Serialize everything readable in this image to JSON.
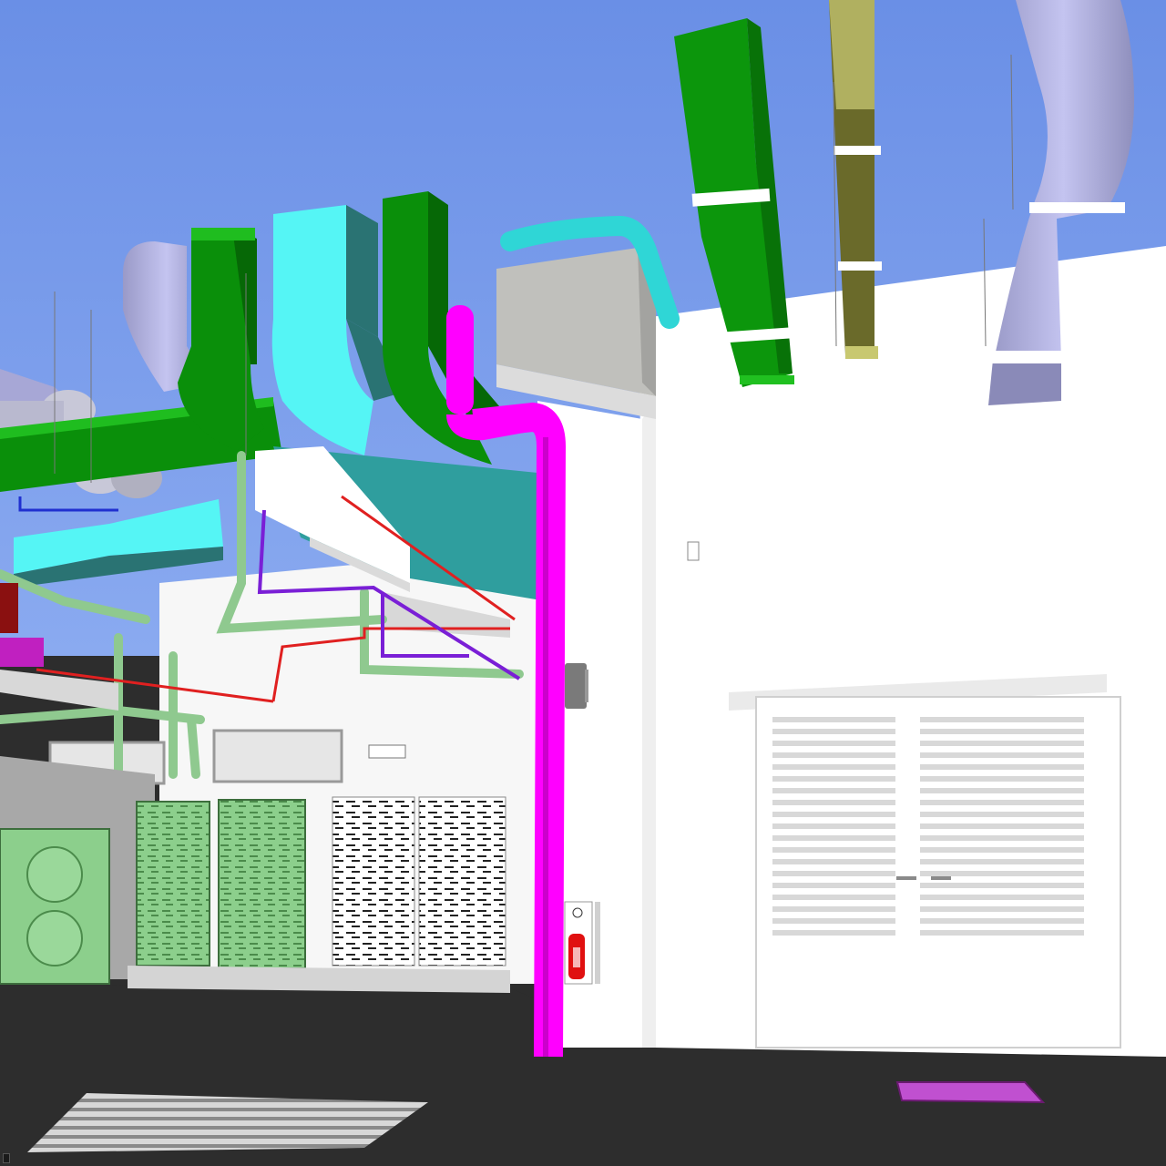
{
  "viewport": {
    "status_text": "",
    "colors": {
      "sky_top": "#6a8fe6",
      "sky_bottom": "#8aaaf0",
      "floor": "#2d2d2d",
      "wall": "#ffffff",
      "duct_green": "#0a8f0a",
      "duct_cyan": "#3ee6e6",
      "duct_lavender": "#b7b7e8",
      "duct_olive": "#a9a957",
      "pipe_magenta": "#ff00ff",
      "pipe_red": "#e02020",
      "pipe_purple": "#7a1fd6",
      "pipe_lightgreen": "#8fc98f",
      "equipment_green": "#8ccf8c",
      "extinguisher_red": "#e01010",
      "floor_grate_purple": "#c050d0"
    },
    "objects": [
      "lavender-duct-left",
      "green-duct-upper-left",
      "cyan-duct-center",
      "green-duct-center",
      "magenta-riser-pipe",
      "cyan-pipe-top",
      "grey-air-handler",
      "green-duct-right",
      "olive-duct-right",
      "lavender-duct-right",
      "outdoor-condenser-units",
      "louvered-double-door",
      "fire-extinguisher",
      "wall-light",
      "floor-drain-grate",
      "purple-floor-grate"
    ]
  }
}
